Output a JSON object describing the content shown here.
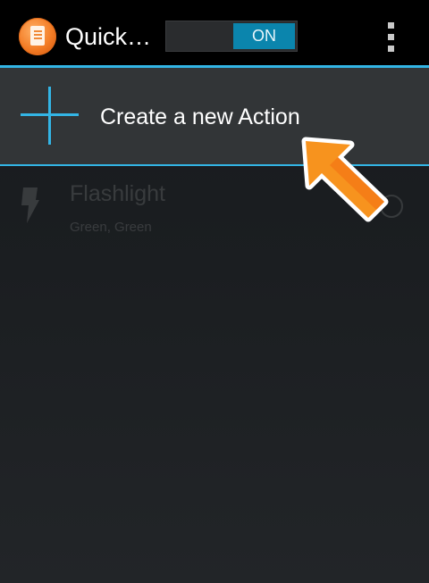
{
  "action_bar": {
    "app_title": "Quick…",
    "toggle_label": "ON",
    "app_icon": "quick-actions-app-icon",
    "overflow_icon": "overflow-menu-icon",
    "accent_color": "#33b5e5"
  },
  "create_row": {
    "label": "Create a new Action",
    "icon": "plus-icon"
  },
  "list": {
    "items": [
      {
        "title": "Flashlight",
        "subtitle": "Green, Green",
        "icon": "flashlight-icon"
      }
    ]
  },
  "annotation": {
    "icon": "arrow-pointer-icon",
    "color": "#f7931e"
  }
}
